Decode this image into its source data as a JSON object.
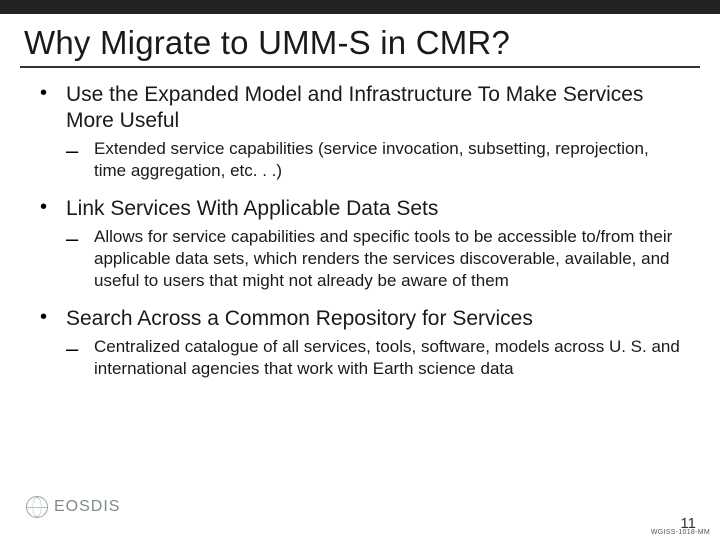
{
  "title": "Why Migrate to UMM-S in CMR?",
  "bullets": [
    {
      "text": "Use the Expanded Model and Infrastructure To Make Services More Useful",
      "sub": "Extended service capabilities (service invocation, subsetting, reprojection, time aggregation, etc. . .)"
    },
    {
      "text": "Link Services With Applicable Data Sets",
      "sub": "Allows for service capabilities and specific tools to be accessible to/from their applicable data sets, which renders the services discoverable, available, and useful to users that might not already be aware of them"
    },
    {
      "text": "Search Across a Common Repository for Services",
      "sub": "Centralized catalogue of all services, tools, software, models across U. S. and international agencies that work with Earth science data"
    }
  ],
  "logo": "EOSDIS",
  "page_number": "11",
  "footer_code": "WGISS-1018-MM"
}
